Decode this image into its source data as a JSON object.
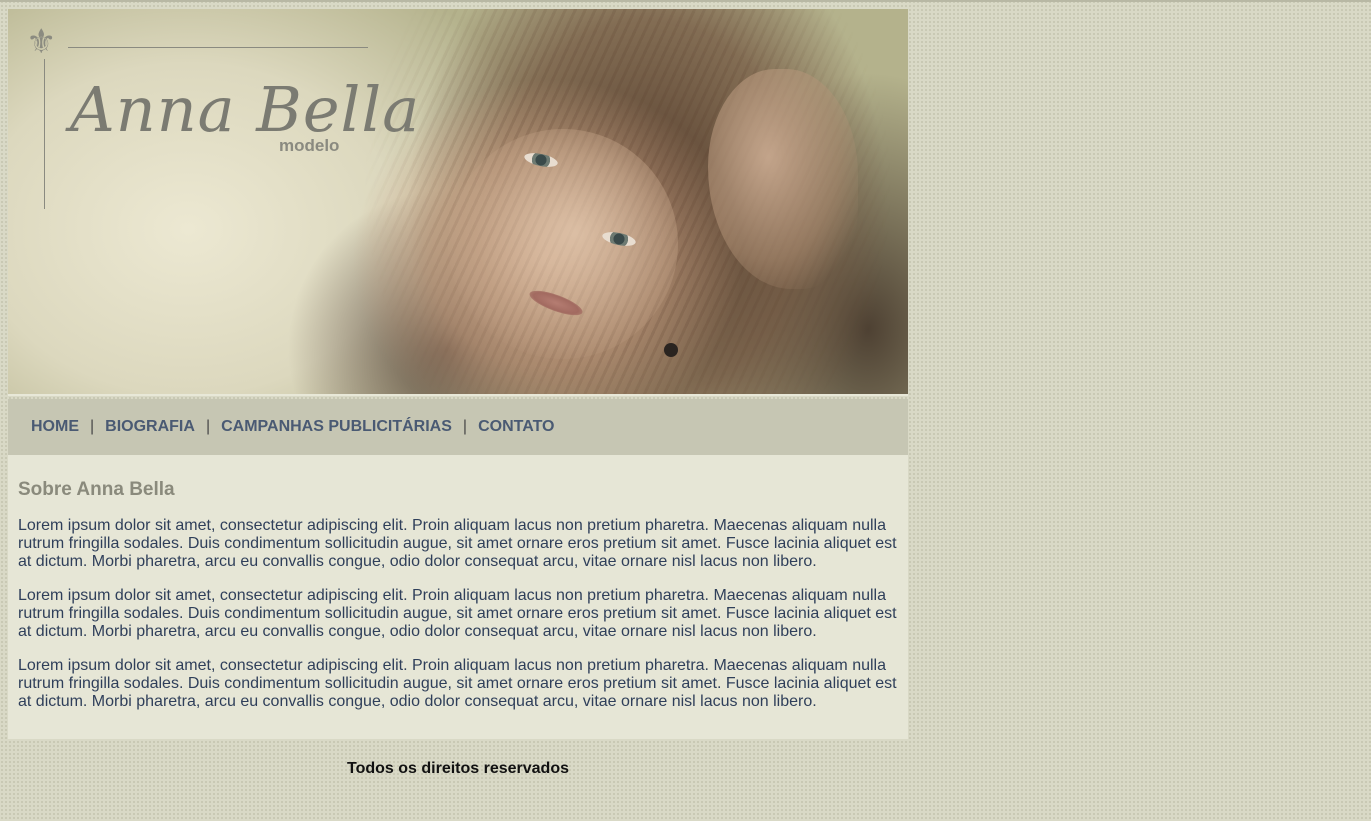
{
  "header": {
    "logo_mark": "⚜",
    "logo_name": "Anna Bella",
    "logo_subtitle": "modelo",
    "logo_icon": "fleur-de-lis-icon",
    "image_subject": "model-portrait"
  },
  "nav": {
    "items": [
      {
        "label": "HOME"
      },
      {
        "label": "BIOGRAFIA"
      },
      {
        "label": "CAMPANHAS PUBLICITÁRIAS"
      },
      {
        "label": "CONTATO"
      }
    ],
    "separator": "|",
    "link_color": "#4a5a73"
  },
  "content": {
    "title": "Sobre Anna Bella",
    "paragraphs": [
      "Lorem ipsum dolor sit amet, consectetur adipiscing elit. Proin aliquam lacus non pretium pharetra. Maecenas aliquam nulla rutrum fringilla sodales. Duis condimentum sollicitudin augue, sit amet ornare eros pretium sit amet. Fusce lacinia aliquet est at dictum. Morbi pharetra, arcu eu convallis congue, odio dolor consequat arcu, vitae ornare nisl lacus non libero.",
      "Lorem ipsum dolor sit amet, consectetur adipiscing elit. Proin aliquam lacus non pretium pharetra. Maecenas aliquam nulla rutrum fringilla sodales. Duis condimentum sollicitudin augue, sit amet ornare eros pretium sit amet. Fusce lacinia aliquet est at dictum. Morbi pharetra, arcu eu convallis congue, odio dolor consequat arcu, vitae ornare nisl lacus non libero.",
      "Lorem ipsum dolor sit amet, consectetur adipiscing elit. Proin aliquam lacus non pretium pharetra. Maecenas aliquam nulla rutrum fringilla sodales. Duis condimentum sollicitudin augue, sit amet ornare eros pretium sit amet. Fusce lacinia aliquet est at dictum. Morbi pharetra, arcu eu convallis congue, odio dolor consequat arcu, vitae ornare nisl lacus non libero."
    ]
  },
  "footer": {
    "text": "Todos os direitos reservados"
  },
  "colors": {
    "page_background": "#d9d9c6",
    "nav_background": "#c6c6b3",
    "content_background": "#e6e6d6",
    "title_color": "#8a8a7c",
    "body_text_color": "#2f3f5a"
  }
}
